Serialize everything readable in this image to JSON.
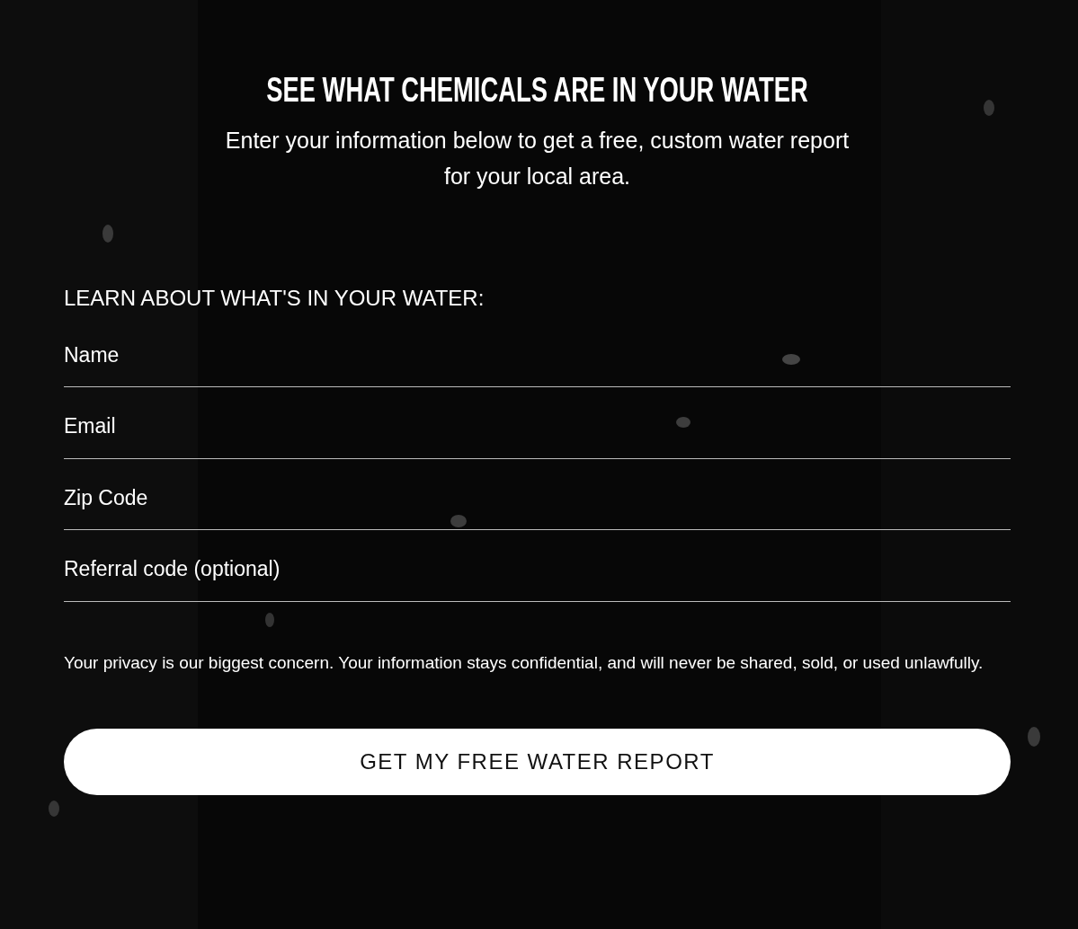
{
  "title": "SEE WHAT CHEMICALS ARE IN YOUR WATER",
  "subtitle": "Enter your information below to get a free, custom water report for your local area.",
  "form": {
    "heading": "LEARN ABOUT WHAT'S IN YOUR WATER:",
    "fields": [
      {
        "placeholder": "Name"
      },
      {
        "placeholder": "Email"
      },
      {
        "placeholder": "Zip Code"
      },
      {
        "placeholder": "Referral code (optional)"
      }
    ],
    "privacy_note": "Your privacy is our biggest concern. Your information stays confidential, and will never be shared, sold, or used unlawfully.",
    "submit_button": "GET MY FREE WATER REPORT"
  }
}
